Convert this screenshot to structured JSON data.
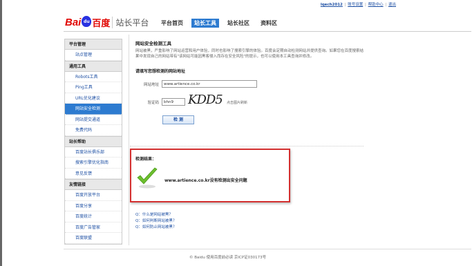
{
  "topbar": {
    "username": "lqech2012",
    "links": [
      "账号设置",
      "帮助中心",
      "退出"
    ]
  },
  "logo": {
    "bai": "Bai",
    "du": "du",
    "baidu_cn": "百度",
    "site_name": "站长平台"
  },
  "nav": {
    "items": [
      "平台首页",
      "站长工具",
      "站长社区",
      "资料区"
    ],
    "active_index": 1
  },
  "sidebar": {
    "groups": [
      {
        "title": "平台管理",
        "items": [
          "站点管理"
        ]
      },
      {
        "title": "通用工具",
        "items": [
          "Robots工具",
          "Ping工具",
          "URL优化建议",
          "网站安全检测",
          "网站提交通道",
          "免费代码"
        ]
      },
      {
        "title": "站长帮助",
        "items": [
          "百度站长俱乐部",
          "搜索引擎优化指南",
          "意见反馈"
        ]
      },
      {
        "title": "友情链接",
        "items": [
          "百度开放平台",
          "百度分享",
          "百度统计",
          "百度广告管家",
          "百度联盟"
        ]
      }
    ],
    "active_item": "网站安全检测"
  },
  "main": {
    "section_title": "网站安全检测工具",
    "description": "网站被黑，严重影响了网站运营和用户体验，同时也影响了搜索引擎的体验。百度会定期自动检测网站并提供查询。如果您在百度搜索结果中发现自己的网站带有\"该网站可能因黑客侵入而存在安全风险\"的提示，也可以使用本工具查询并修改。",
    "sub_title": "请填写您想检测的网站地址",
    "url_label": "网站地址",
    "url_value": "www.artience.co.kr",
    "code_label": "验证码",
    "code_value": "bhn9",
    "captcha_text": "KDD5",
    "captcha_tip": "点击图片刷新",
    "check_button": "检 测"
  },
  "result": {
    "title": "检测结果：",
    "message": "www.artience.co.kr没有检测出安全问题",
    "accent_color": "#d32f2f",
    "icon": "green-check-icon"
  },
  "faq": [
    "Q：什么是网站被黑？",
    "Q：如何判断网站被黑？",
    "Q：如何防止网站被黑？"
  ],
  "footer": "© Baidu 使用百度前必读 京ICP证030173号"
}
